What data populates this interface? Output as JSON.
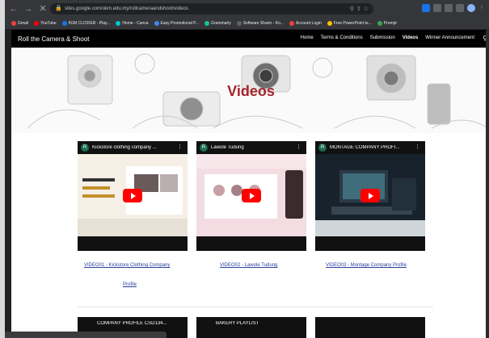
{
  "browser": {
    "url": "sites.google.com/ukm.edu.my/rollcameraandshoot/videos",
    "bookmarks": [
      {
        "label": "Gmail",
        "color": "#ea4335"
      },
      {
        "label": "YouTube",
        "color": "#ff0000"
      },
      {
        "label": "IIUM CLICKER - Play...",
        "color": "#1a73e8"
      },
      {
        "label": "Home - Canva",
        "color": "#00c4cc"
      },
      {
        "label": "Easy Promotional P...",
        "color": "#4285f4"
      },
      {
        "label": "Grammarly",
        "color": "#15c39a"
      },
      {
        "label": "Software Sharin - Ko...",
        "color": "#5f6368"
      },
      {
        "label": "Account Login",
        "color": "#ea4335"
      },
      {
        "label": "Free PowerPoint te...",
        "color": "#fbbc04"
      },
      {
        "label": "Prompt",
        "color": "#34a853"
      }
    ]
  },
  "site": {
    "title": "Roll the Camera & Shoot",
    "menu": [
      "Home",
      "Terms & Conditions",
      "Submission",
      "Videos",
      "Winner Announcement"
    ],
    "hero_title": "Videos"
  },
  "videos": [
    {
      "channel_initial": "R",
      "title": "Kickstore clothing company ...",
      "link": "VIDEO01 - Kickstore Clothing Company",
      "link_line2": "Profile"
    },
    {
      "channel_initial": "R",
      "title": "Lawole Tudung",
      "link": "VIDEO02 - Lawole Tudung",
      "link_line2": ""
    },
    {
      "channel_initial": "R",
      "title": "MONTAGE COMPANY PROFI...",
      "link": "VIDEO03 - Montage Company Profile",
      "link_line2": ""
    }
  ],
  "videos_row2": [
    {
      "title": "COMPANY PROFILE CSD134..."
    },
    {
      "title": "BAKERY PLAYLIST"
    },
    {
      "title": ""
    }
  ],
  "colors": {
    "accent": "#a3242a",
    "link": "#2a3f9c"
  }
}
